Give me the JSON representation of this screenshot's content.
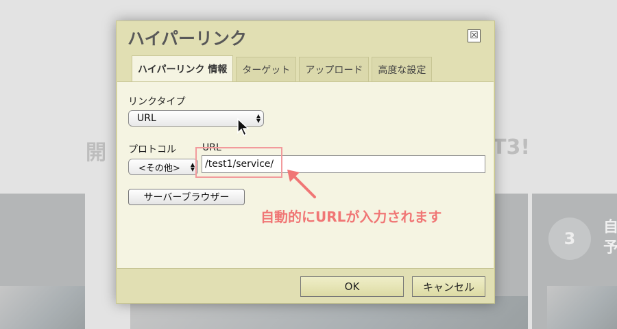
{
  "background": {
    "left_heading": "開",
    "right_heading": "T3!",
    "step_number": "3",
    "side_text": "自\n予"
  },
  "dialog": {
    "title": "ハイパーリンク",
    "close_glyph": "☒",
    "tabs": [
      {
        "label": "ハイパーリンク 情報",
        "active": true
      },
      {
        "label": "ターゲット",
        "active": false
      },
      {
        "label": "アップロード",
        "active": false
      },
      {
        "label": "高度な設定",
        "active": false
      }
    ],
    "link_type": {
      "label": "リンクタイプ",
      "value": "URL"
    },
    "protocol": {
      "label": "プロトコル",
      "value": "<その他>"
    },
    "url": {
      "label": "URL",
      "value": "/test1/service/"
    },
    "browse_button": "サーバーブラウザー",
    "ok_button": "OK",
    "cancel_button": "キャンセル"
  },
  "annotation": {
    "text": "自動的にURLが入力されます",
    "color": "#f07675"
  },
  "colors": {
    "dialog_bg": "#e1dfb3",
    "content_bg": "#f5f4e2",
    "accent": "#f29a9c"
  }
}
